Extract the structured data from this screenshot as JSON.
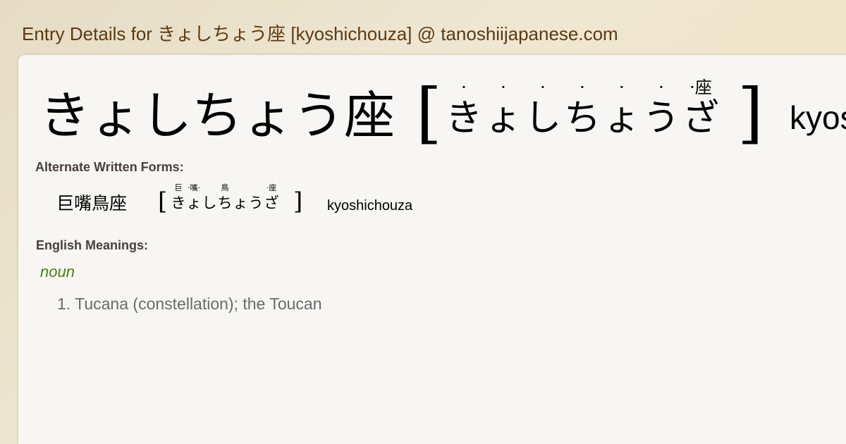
{
  "header": {
    "title": "Entry Details for きょしちょう座 [kyoshichouza] @ tanoshiijapanese.com"
  },
  "entry": {
    "kanji": "きょしちょう座",
    "bracket_open": "[",
    "bracket_close": "]",
    "reading_chars": [
      "き",
      "ょ",
      "し",
      "ち",
      "ょ",
      "う",
      "ざ"
    ],
    "reading_ruby": [
      "·",
      "·",
      "·",
      "·",
      "·",
      "·",
      "·座"
    ],
    "romaji": "kyoshichouza"
  },
  "alternate_forms": {
    "label": "Alternate Written Forms:",
    "items": [
      {
        "kanji": "巨嘴鳥座",
        "bracket_open": "[",
        "bracket_close": "]",
        "reading_chars": [
          "き",
          "ょ",
          "し",
          "ち",
          "ょ",
          "う",
          "ざ"
        ],
        "reading_ruby": [
          "巨",
          "·嘴·",
          "",
          "鳥",
          "",
          "",
          "·座"
        ],
        "romaji": "kyoshichouza"
      }
    ]
  },
  "meanings": {
    "label": "English Meanings:",
    "part_of_speech": "noun",
    "items": [
      "1. Tucana (constellation); the Toucan"
    ]
  },
  "colors": {
    "header": "#5c3a12",
    "part_of_speech": "#4c7e12",
    "meaning_text": "#6a6a6a",
    "label_text": "#47403a"
  }
}
